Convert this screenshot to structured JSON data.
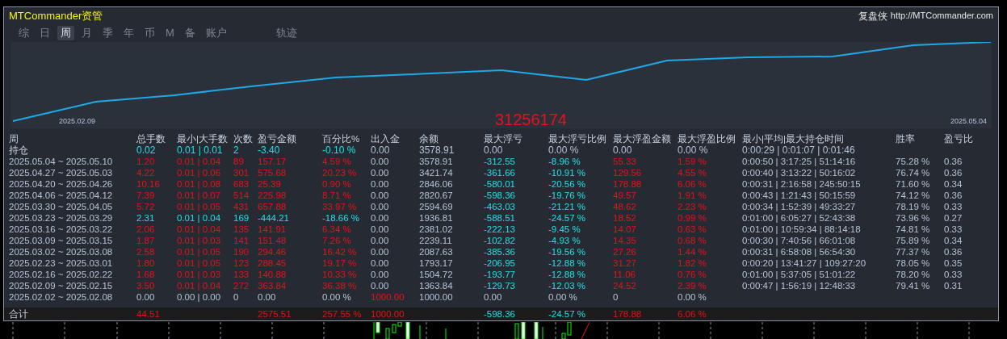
{
  "window": {
    "title": "MTCommander资管",
    "right_label": "复盘侠",
    "url": "http://MTCommander.com"
  },
  "tabs": [
    {
      "label": "综",
      "selected": false
    },
    {
      "label": "日",
      "selected": false
    },
    {
      "label": "周",
      "selected": true
    },
    {
      "label": "月",
      "selected": false
    },
    {
      "label": "季",
      "selected": false
    },
    {
      "label": "年",
      "selected": false
    },
    {
      "label": "币",
      "selected": false
    },
    {
      "label": "M",
      "selected": false
    },
    {
      "label": "备",
      "selected": false
    },
    {
      "label": "账户",
      "selected": false
    },
    {
      "label": "轨迹",
      "selected": false
    }
  ],
  "equity_chart": {
    "start_date": "2025.02.09",
    "end_date": "2025.05.04",
    "overlay_number": "31256174"
  },
  "table": {
    "columns": [
      "周",
      "总手数",
      "最小|大手数",
      "次数",
      "盈亏金额",
      "百分比%",
      "出入金",
      "余额",
      "最大浮亏",
      "最大浮亏比例",
      "最大浮盈金额",
      "最大浮盈比例",
      "最小|平均|最大持仓时间",
      "胜率",
      "盈亏比"
    ],
    "rows": [
      {
        "kind": "open",
        "cells": [
          {
            "text": "持仓",
            "kind": "label"
          },
          {
            "text": "0.02",
            "kind": "loss"
          },
          {
            "text": "0.01 | 0.01",
            "kind": "loss"
          },
          {
            "text": "2",
            "kind": "loss"
          },
          {
            "text": "-3.40",
            "kind": "loss"
          },
          {
            "text": "-0.10 %",
            "kind": "loss"
          },
          {
            "text": "0.00",
            "kind": "plain"
          },
          {
            "text": "3578.91",
            "kind": "plain"
          },
          {
            "text": "0.00",
            "kind": "plain"
          },
          {
            "text": "0.00 %",
            "kind": "plain"
          },
          {
            "text": "0.00",
            "kind": "plain"
          },
          {
            "text": "0.00 %",
            "kind": "plain"
          },
          {
            "text": "0:00:29 | 0:01:07 | 0:01:46",
            "kind": "plain"
          }
        ]
      },
      {
        "kind": "week",
        "cells": [
          {
            "text": "2025.05.04 ~ 2025.05.10",
            "kind": "plain"
          },
          {
            "text": "1.20",
            "kind": "gain"
          },
          {
            "text": "0.01 | 0.04",
            "kind": "gain"
          },
          {
            "text": "89",
            "kind": "gain"
          },
          {
            "text": "157.17",
            "kind": "gain"
          },
          {
            "text": "4.59 %",
            "kind": "gain"
          },
          {
            "text": "0.00",
            "kind": "plain"
          },
          {
            "text": "3578.91",
            "kind": "plain"
          },
          {
            "text": "-312.55",
            "kind": "loss"
          },
          {
            "text": "-8.96 %",
            "kind": "loss"
          },
          {
            "text": "55.33",
            "kind": "gain"
          },
          {
            "text": "1.59 %",
            "kind": "gain"
          },
          {
            "text": "0:00:50 | 3:17:25 | 51:14:16",
            "kind": "plain"
          },
          {
            "text": "75.28 %",
            "kind": "plain"
          },
          {
            "text": "0.36",
            "kind": "plain"
          }
        ]
      },
      {
        "kind": "week",
        "cells": [
          {
            "text": "2025.04.27 ~ 2025.05.03",
            "kind": "plain"
          },
          {
            "text": "4.22",
            "kind": "gain"
          },
          {
            "text": "0.01 | 0.06",
            "kind": "gain"
          },
          {
            "text": "301",
            "kind": "gain"
          },
          {
            "text": "575.68",
            "kind": "gain"
          },
          {
            "text": "20.23 %",
            "kind": "gain"
          },
          {
            "text": "0.00",
            "kind": "plain"
          },
          {
            "text": "3421.74",
            "kind": "plain"
          },
          {
            "text": "-361.66",
            "kind": "loss"
          },
          {
            "text": "-10.91 %",
            "kind": "loss"
          },
          {
            "text": "129.56",
            "kind": "gain"
          },
          {
            "text": "4.55 %",
            "kind": "gain"
          },
          {
            "text": "0:00:40 | 3:13:22 | 50:16:02",
            "kind": "plain"
          },
          {
            "text": "76.74 %",
            "kind": "plain"
          },
          {
            "text": "0.36",
            "kind": "plain"
          }
        ]
      },
      {
        "kind": "week",
        "cells": [
          {
            "text": "2025.04.20 ~ 2025.04.26",
            "kind": "plain"
          },
          {
            "text": "10.16",
            "kind": "gain"
          },
          {
            "text": "0.01 | 0.08",
            "kind": "gain"
          },
          {
            "text": "683",
            "kind": "gain"
          },
          {
            "text": "25.39",
            "kind": "gain"
          },
          {
            "text": "0.90 %",
            "kind": "gain"
          },
          {
            "text": "0.00",
            "kind": "plain"
          },
          {
            "text": "2846.06",
            "kind": "plain"
          },
          {
            "text": "-580.01",
            "kind": "loss"
          },
          {
            "text": "-20.56 %",
            "kind": "loss"
          },
          {
            "text": "178.88",
            "kind": "gain"
          },
          {
            "text": "6.06 %",
            "kind": "gain"
          },
          {
            "text": "0:00:31 | 2:16:58 | 245:50:15",
            "kind": "plain"
          },
          {
            "text": "71.60 %",
            "kind": "plain"
          },
          {
            "text": "0.34",
            "kind": "plain"
          }
        ]
      },
      {
        "kind": "week",
        "cells": [
          {
            "text": "2025.04.06 ~ 2025.04.12",
            "kind": "plain"
          },
          {
            "text": "7.39",
            "kind": "gain"
          },
          {
            "text": "0.01 | 0.07",
            "kind": "gain"
          },
          {
            "text": "514",
            "kind": "gain"
          },
          {
            "text": "225.98",
            "kind": "gain"
          },
          {
            "text": "8.71 %",
            "kind": "gain"
          },
          {
            "text": "0.00",
            "kind": "plain"
          },
          {
            "text": "2820.67",
            "kind": "plain"
          },
          {
            "text": "-598.36",
            "kind": "loss"
          },
          {
            "text": "-19.76 %",
            "kind": "loss"
          },
          {
            "text": "49.57",
            "kind": "gain"
          },
          {
            "text": "1.91 %",
            "kind": "gain"
          },
          {
            "text": "0:00:43 | 1:21:43 | 50:15:59",
            "kind": "plain"
          },
          {
            "text": "74.12 %",
            "kind": "plain"
          },
          {
            "text": "0.36",
            "kind": "plain"
          }
        ]
      },
      {
        "kind": "week",
        "cells": [
          {
            "text": "2025.03.30 ~ 2025.04.05",
            "kind": "plain"
          },
          {
            "text": "5.72",
            "kind": "gain"
          },
          {
            "text": "0.01 | 0.05",
            "kind": "gain"
          },
          {
            "text": "431",
            "kind": "gain"
          },
          {
            "text": "657.88",
            "kind": "gain"
          },
          {
            "text": "33.97 %",
            "kind": "gain"
          },
          {
            "text": "0.00",
            "kind": "plain"
          },
          {
            "text": "2594.69",
            "kind": "plain"
          },
          {
            "text": "-463.03",
            "kind": "loss"
          },
          {
            "text": "-21.21 %",
            "kind": "loss"
          },
          {
            "text": "48.62",
            "kind": "gain"
          },
          {
            "text": "2.23 %",
            "kind": "gain"
          },
          {
            "text": "0:00:34 | 1:52:39 | 49:33:27",
            "kind": "plain"
          },
          {
            "text": "78.19 %",
            "kind": "plain"
          },
          {
            "text": "0.33",
            "kind": "plain"
          }
        ]
      },
      {
        "kind": "week",
        "cells": [
          {
            "text": "2025.03.23 ~ 2025.03.29",
            "kind": "plain"
          },
          {
            "text": "2.31",
            "kind": "loss"
          },
          {
            "text": "0.01 | 0.04",
            "kind": "loss"
          },
          {
            "text": "169",
            "kind": "loss"
          },
          {
            "text": "-444.21",
            "kind": "loss"
          },
          {
            "text": "-18.66 %",
            "kind": "loss"
          },
          {
            "text": "0.00",
            "kind": "plain"
          },
          {
            "text": "1936.81",
            "kind": "plain"
          },
          {
            "text": "-588.51",
            "kind": "loss"
          },
          {
            "text": "-24.57 %",
            "kind": "loss"
          },
          {
            "text": "18.52",
            "kind": "gain"
          },
          {
            "text": "0.99 %",
            "kind": "gain"
          },
          {
            "text": "0:01:00 | 6:05:27 | 52:43:38",
            "kind": "plain"
          },
          {
            "text": "73.96 %",
            "kind": "plain"
          },
          {
            "text": "0.27",
            "kind": "plain"
          }
        ]
      },
      {
        "kind": "week",
        "cells": [
          {
            "text": "2025.03.16 ~ 2025.03.22",
            "kind": "plain"
          },
          {
            "text": "2.06",
            "kind": "gain"
          },
          {
            "text": "0.01 | 0.04",
            "kind": "gain"
          },
          {
            "text": "135",
            "kind": "gain"
          },
          {
            "text": "141.91",
            "kind": "gain"
          },
          {
            "text": "6.34 %",
            "kind": "gain"
          },
          {
            "text": "0.00",
            "kind": "plain"
          },
          {
            "text": "2381.02",
            "kind": "plain"
          },
          {
            "text": "-222.13",
            "kind": "loss"
          },
          {
            "text": "-9.45 %",
            "kind": "loss"
          },
          {
            "text": "14.07",
            "kind": "gain"
          },
          {
            "text": "0.63 %",
            "kind": "gain"
          },
          {
            "text": "0:01:00 | 10:59:34 | 88:14:18",
            "kind": "plain"
          },
          {
            "text": "74.81 %",
            "kind": "plain"
          },
          {
            "text": "0.33",
            "kind": "plain"
          }
        ]
      },
      {
        "kind": "week",
        "cells": [
          {
            "text": "2025.03.09 ~ 2025.03.15",
            "kind": "plain"
          },
          {
            "text": "1.87",
            "kind": "gain"
          },
          {
            "text": "0.01 | 0.03",
            "kind": "gain"
          },
          {
            "text": "141",
            "kind": "gain"
          },
          {
            "text": "151.48",
            "kind": "gain"
          },
          {
            "text": "7.26 %",
            "kind": "gain"
          },
          {
            "text": "0.00",
            "kind": "plain"
          },
          {
            "text": "2239.11",
            "kind": "plain"
          },
          {
            "text": "-102.82",
            "kind": "loss"
          },
          {
            "text": "-4.93 %",
            "kind": "loss"
          },
          {
            "text": "14.35",
            "kind": "gain"
          },
          {
            "text": "0.68 %",
            "kind": "gain"
          },
          {
            "text": "0:00:30 | 7:40:56 | 66:01:08",
            "kind": "plain"
          },
          {
            "text": "75.89 %",
            "kind": "plain"
          },
          {
            "text": "0.34",
            "kind": "plain"
          }
        ]
      },
      {
        "kind": "week",
        "cells": [
          {
            "text": "2025.03.02 ~ 2025.03.08",
            "kind": "plain"
          },
          {
            "text": "2.58",
            "kind": "gain"
          },
          {
            "text": "0.01 | 0.05",
            "kind": "gain"
          },
          {
            "text": "190",
            "kind": "gain"
          },
          {
            "text": "294.46",
            "kind": "gain"
          },
          {
            "text": "16.42 %",
            "kind": "gain"
          },
          {
            "text": "0.00",
            "kind": "plain"
          },
          {
            "text": "2087.63",
            "kind": "plain"
          },
          {
            "text": "-385.36",
            "kind": "loss"
          },
          {
            "text": "-19.56 %",
            "kind": "loss"
          },
          {
            "text": "27.26",
            "kind": "gain"
          },
          {
            "text": "1.44 %",
            "kind": "gain"
          },
          {
            "text": "0:00:31 | 6:58:08 | 56:54:30",
            "kind": "plain"
          },
          {
            "text": "77.37 %",
            "kind": "plain"
          },
          {
            "text": "0.36",
            "kind": "plain"
          }
        ]
      },
      {
        "kind": "week",
        "cells": [
          {
            "text": "2025.02.23 ~ 2025.03.01",
            "kind": "plain"
          },
          {
            "text": "1.80",
            "kind": "gain"
          },
          {
            "text": "0.01 | 0.05",
            "kind": "gain"
          },
          {
            "text": "123",
            "kind": "gain"
          },
          {
            "text": "288.45",
            "kind": "gain"
          },
          {
            "text": "19.17 %",
            "kind": "gain"
          },
          {
            "text": "0.00",
            "kind": "plain"
          },
          {
            "text": "1793.17",
            "kind": "plain"
          },
          {
            "text": "-206.95",
            "kind": "loss"
          },
          {
            "text": "-12.88 %",
            "kind": "loss"
          },
          {
            "text": "31.27",
            "kind": "gain"
          },
          {
            "text": "1.82 %",
            "kind": "gain"
          },
          {
            "text": "0:00:20 | 13:41:27 | 109:27:20",
            "kind": "plain"
          },
          {
            "text": "78.05 %",
            "kind": "plain"
          },
          {
            "text": "0.35",
            "kind": "plain"
          }
        ]
      },
      {
        "kind": "week",
        "cells": [
          {
            "text": "2025.02.16 ~ 2025.02.22",
            "kind": "plain"
          },
          {
            "text": "1.68",
            "kind": "gain"
          },
          {
            "text": "0.01 | 0.03",
            "kind": "gain"
          },
          {
            "text": "133",
            "kind": "gain"
          },
          {
            "text": "140.88",
            "kind": "gain"
          },
          {
            "text": "10.33 %",
            "kind": "gain"
          },
          {
            "text": "0.00",
            "kind": "plain"
          },
          {
            "text": "1504.72",
            "kind": "plain"
          },
          {
            "text": "-193.77",
            "kind": "loss"
          },
          {
            "text": "-12.88 %",
            "kind": "loss"
          },
          {
            "text": "11.06",
            "kind": "gain"
          },
          {
            "text": "0.76 %",
            "kind": "gain"
          },
          {
            "text": "0:01:00 | 5:37:05 | 51:01:22",
            "kind": "plain"
          },
          {
            "text": "78.20 %",
            "kind": "plain"
          },
          {
            "text": "0.33",
            "kind": "plain"
          }
        ]
      },
      {
        "kind": "week",
        "cells": [
          {
            "text": "2025.02.09 ~ 2025.02.15",
            "kind": "plain"
          },
          {
            "text": "3.50",
            "kind": "gain"
          },
          {
            "text": "0.01 | 0.04",
            "kind": "gain"
          },
          {
            "text": "272",
            "kind": "gain"
          },
          {
            "text": "363.84",
            "kind": "gain"
          },
          {
            "text": "36.38 %",
            "kind": "gain"
          },
          {
            "text": "0.00",
            "kind": "plain"
          },
          {
            "text": "1363.84",
            "kind": "plain"
          },
          {
            "text": "-129.73",
            "kind": "loss"
          },
          {
            "text": "-12.03 %",
            "kind": "loss"
          },
          {
            "text": "24.52",
            "kind": "gain"
          },
          {
            "text": "2.39 %",
            "kind": "gain"
          },
          {
            "text": "0:00:47 | 1:56:19 | 12:48:33",
            "kind": "plain"
          },
          {
            "text": "79.41 %",
            "kind": "plain"
          },
          {
            "text": "0.31",
            "kind": "plain"
          }
        ]
      },
      {
        "kind": "week",
        "cells": [
          {
            "text": "2025.02.02 ~ 2025.02.08",
            "kind": "plain"
          },
          {
            "text": "0.00",
            "kind": "plain"
          },
          {
            "text": "0.00 | 0.00",
            "kind": "plain"
          },
          {
            "text": "0",
            "kind": "plain"
          },
          {
            "text": "0.00",
            "kind": "plain"
          },
          {
            "text": "0.00 %",
            "kind": "plain"
          },
          {
            "text": "1000.00",
            "kind": "gain"
          },
          {
            "text": "1000.00",
            "kind": "plain"
          },
          {
            "text": "0.00",
            "kind": "plain"
          },
          {
            "text": "0.00 %",
            "kind": "plain"
          },
          {
            "text": "0",
            "kind": "plain"
          },
          {
            "text": "0.00 %",
            "kind": "plain"
          }
        ]
      }
    ],
    "total": {
      "cells": [
        {
          "text": "合计",
          "kind": "label"
        },
        {
          "text": "44.51",
          "kind": "gain"
        },
        null,
        null,
        {
          "text": "2575.51",
          "kind": "gain"
        },
        {
          "text": "257.55 %",
          "kind": "gain"
        },
        {
          "text": "1000.00",
          "kind": "gain"
        },
        null,
        {
          "text": "-598.36",
          "kind": "loss"
        },
        {
          "text": "-24.57 %",
          "kind": "loss"
        },
        {
          "text": "178.88",
          "kind": "gain"
        },
        {
          "text": "6.06 %",
          "kind": "gain"
        }
      ]
    }
  }
}
